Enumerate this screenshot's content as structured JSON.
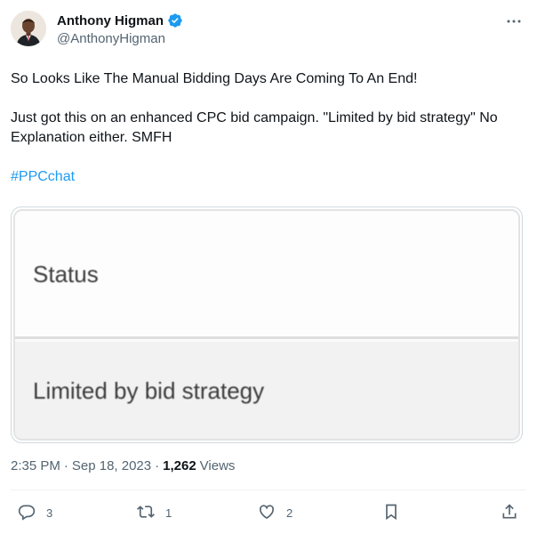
{
  "author": {
    "display_name": "Anthony Higman",
    "handle": "@AnthonyHigman",
    "verified": true
  },
  "tweet": {
    "line1": "So Looks Like The Manual Bidding Days Are Coming To An End!",
    "line2": "Just got this on an enhanced CPC bid campaign. \"Limited by bid strategy\" No Explanation either. SMFH",
    "hashtag": "#PPCchat"
  },
  "media": {
    "status_label": "Status",
    "status_value": "Limited by bid strategy"
  },
  "meta": {
    "time": "2:35 PM",
    "separator": "·",
    "date": "Sep 18, 2023",
    "views_count": "1,262",
    "views_label": "Views"
  },
  "actions": {
    "replies": "3",
    "retweets": "1",
    "likes": "2"
  },
  "colors": {
    "accent": "#1d9bf0",
    "text": "#0f1419",
    "secondary": "#536471"
  },
  "icons": {
    "more": "more-horizontal-icon",
    "verified": "verified-badge-icon",
    "reply": "reply-icon",
    "retweet": "retweet-icon",
    "like": "heart-icon",
    "bookmark": "bookmark-icon",
    "share": "share-icon"
  }
}
